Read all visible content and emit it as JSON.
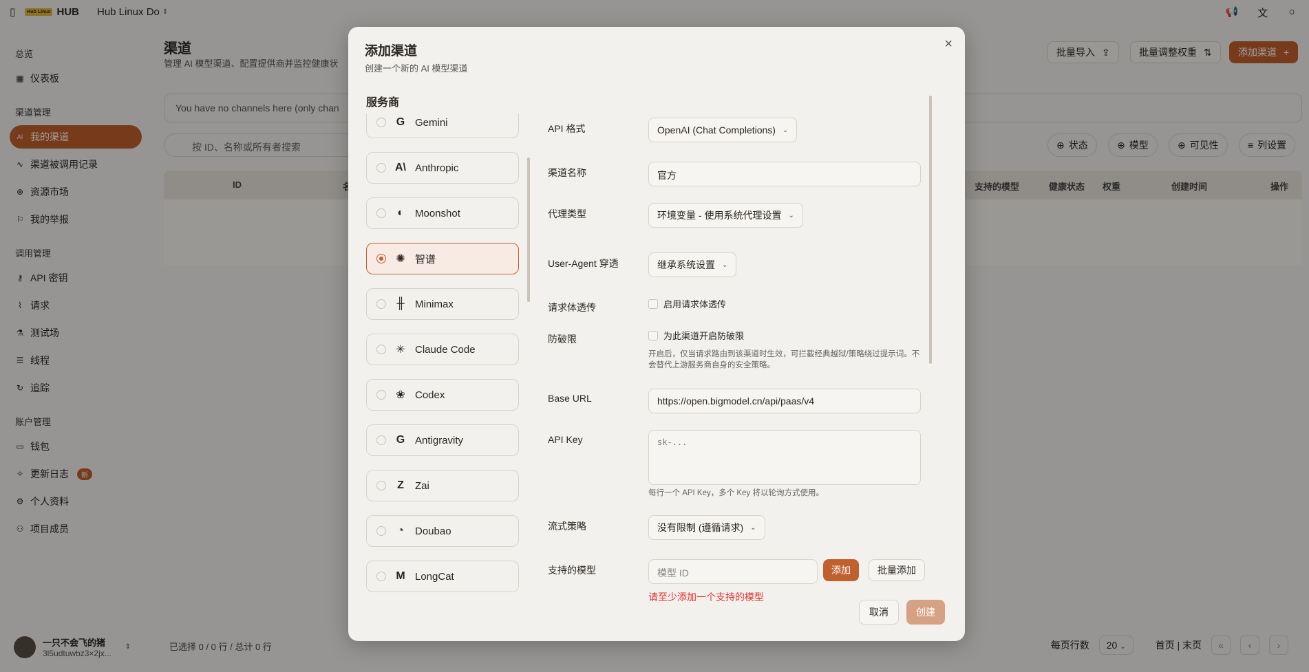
{
  "topbar": {
    "brand_badge": "Hub Linux",
    "brand": "HUB",
    "workspace": "Hub Linux Do",
    "icons": [
      "sidebar-toggle-icon",
      "megaphone-icon",
      "translate-icon",
      "sun-icon"
    ]
  },
  "sidebar": {
    "groups": [
      {
        "title": "总览",
        "items": [
          {
            "label": "仪表板",
            "icon": "dashboard-icon"
          }
        ]
      },
      {
        "title": "渠道管理",
        "items": [
          {
            "label": "我的渠道",
            "icon": "ai-icon",
            "active": true
          },
          {
            "label": "渠道被调用记录",
            "icon": "activity-icon"
          },
          {
            "label": "资源市场",
            "icon": "globe-icon"
          },
          {
            "label": "我的举报",
            "icon": "flag-icon"
          }
        ]
      },
      {
        "title": "调用管理",
        "items": [
          {
            "label": "API 密钥",
            "icon": "key-icon"
          },
          {
            "label": "请求",
            "icon": "pulse-icon"
          },
          {
            "label": "测试场",
            "icon": "flask-icon"
          },
          {
            "label": "线程",
            "icon": "list-icon"
          },
          {
            "label": "追踪",
            "icon": "trace-icon"
          }
        ]
      },
      {
        "title": "账户管理",
        "items": [
          {
            "label": "钱包",
            "icon": "wallet-icon"
          },
          {
            "label": "更新日志",
            "icon": "sparkle-icon",
            "badge": "新"
          },
          {
            "label": "个人资料",
            "icon": "gear-icon"
          },
          {
            "label": "项目成员",
            "icon": "users-icon"
          }
        ]
      }
    ],
    "user": {
      "name": "一只不会飞的猪",
      "id": "3l5udtuwbz3×2jx..."
    }
  },
  "main": {
    "title": "渠道",
    "subtitle": "管理 AI 模型渠道、配置提供商并监控健康状",
    "buttons": {
      "import": "批量导入",
      "weights": "批量调整权重",
      "add": "添加渠道"
    },
    "notice": "You have no channels here (only chan",
    "search_placeholder": "按 ID、名称或所有者搜索",
    "filters": [
      "状态",
      "模型",
      "可见性",
      "列设置"
    ],
    "table_headers": {
      "id": "ID",
      "name": "名称",
      "models": "支持的模型",
      "health": "健康状态",
      "weight": "权重",
      "created": "创建时间",
      "actions": "操作"
    },
    "footer": "已选择 0 / 0 行 / 总计 0 行",
    "pager": {
      "rows_label": "每页行数",
      "rows_value": "20",
      "first_last": "首页 | 末页"
    }
  },
  "modal": {
    "title": "添加渠道",
    "subtitle": "创建一个新的 AI 模型渠道",
    "provider_label": "服务商",
    "providers": [
      {
        "name": "Gemini",
        "glyph": "G"
      },
      {
        "name": "Anthropic",
        "glyph": "A\\"
      },
      {
        "name": "Moonshot",
        "glyph": "◐"
      },
      {
        "name": "智谱",
        "glyph": "✺",
        "selected": true
      },
      {
        "name": "Minimax",
        "glyph": "╫"
      },
      {
        "name": "Claude Code",
        "glyph": "✳"
      },
      {
        "name": "Codex",
        "glyph": "❀"
      },
      {
        "name": "Antigravity",
        "glyph": "G"
      },
      {
        "name": "Zai",
        "glyph": "Z"
      },
      {
        "name": "Doubao",
        "glyph": "◔"
      },
      {
        "name": "LongCat",
        "glyph": "M"
      }
    ],
    "form": {
      "api_format_label": "API 格式",
      "api_format_value": "OpenAI (Chat Completions)",
      "channel_name_label": "渠道名称",
      "channel_name_value": "官方",
      "proxy_type_label": "代理类型",
      "proxy_type_value": "环境变量 - 使用系统代理设置",
      "user_agent_label": "User-Agent 穿透",
      "user_agent_value": "继承系统设置",
      "body_passthrough_label": "请求体透传",
      "body_passthrough_check": "启用请求体透传",
      "anti_limit_label": "防破限",
      "anti_limit_check": "为此渠道开启防破限",
      "anti_limit_hint": "开启后，仅当请求路由到该渠道时生效，可拦截经典越狱/策略绕过提示词。不会替代上游服务商自身的安全策略。",
      "base_url_label": "Base URL",
      "base_url_value": "https://open.bigmodel.cn/api/paas/v4",
      "api_key_label": "API Key",
      "api_key_placeholder": "sk-...",
      "api_key_hint": "每行一个 API Key，多个 Key 将以轮询方式使用。",
      "stream_label": "流式策略",
      "stream_value": "没有限制 (遵循请求)",
      "models_label": "支持的模型",
      "model_id_placeholder": "模型 ID",
      "add_button": "添加",
      "batch_add_button": "批量添加",
      "models_error": "请至少添加一个支持的模型"
    },
    "cancel": "取消",
    "create": "创建"
  }
}
